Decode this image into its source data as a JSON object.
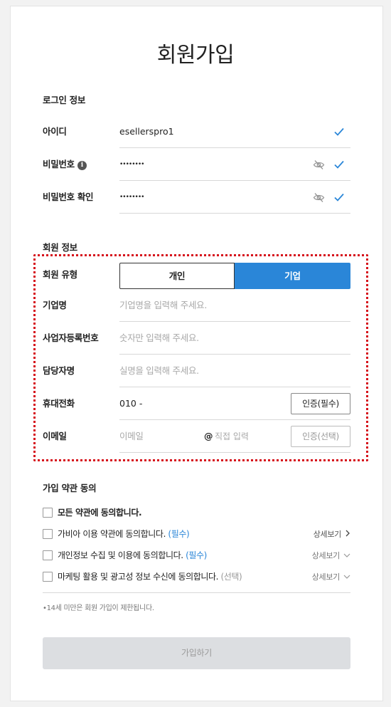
{
  "page_title": "회원가입",
  "login_section": {
    "label": "로그인 정보",
    "id_label": "아이디",
    "id_value": "esellerspro1",
    "password_label": "비밀번호",
    "password_info_icon": "i",
    "password_value": "••••••••",
    "password_confirm_label": "비밀번호 확인",
    "password_confirm_value": "••••••••"
  },
  "member_section": {
    "label": "회원 정보",
    "type_label": "회원 유형",
    "type_options": [
      "개인",
      "기업"
    ],
    "type_selected": "기업",
    "company_label": "기업명",
    "company_placeholder": "기업명을 입력해 주세요.",
    "bizno_label": "사업자등록번호",
    "bizno_placeholder": "숫자만 입력해 주세요.",
    "manager_label": "담당자명",
    "manager_placeholder": "실명을 입력해 주세요.",
    "phone_label": "휴대전화",
    "phone_value": "010 -",
    "phone_verify_button": "인증(필수)",
    "email_label": "이메일",
    "email_placeholder": "이메일",
    "email_at": "@",
    "email_domain_placeholder": "직접 입력",
    "email_verify_button": "인증(선택)"
  },
  "terms_section": {
    "label": "가입 약관 동의",
    "all_agree": "모든 약관에 동의합니다.",
    "items": [
      {
        "text": "가비아 이용 약관에 동의합니다.",
        "tag": "(필수)",
        "detail": "상세보기",
        "chevron": "right"
      },
      {
        "text": "개인정보 수집 및 이용에 동의합니다.",
        "tag": "(필수)",
        "detail": "상세보기",
        "chevron": "down"
      },
      {
        "text": "마케팅 활용 및 광고성 정보 수신에 동의합니다.",
        "tag": "(선택)",
        "detail": "상세보기",
        "chevron": "down"
      }
    ],
    "note": "•14세 미만은 회원 가입이 제한됩니다."
  },
  "submit_label": "가입하기",
  "colors": {
    "accent": "#2a86d8",
    "highlight_border": "#d6121b",
    "disabled_button": "#dcdee1"
  }
}
